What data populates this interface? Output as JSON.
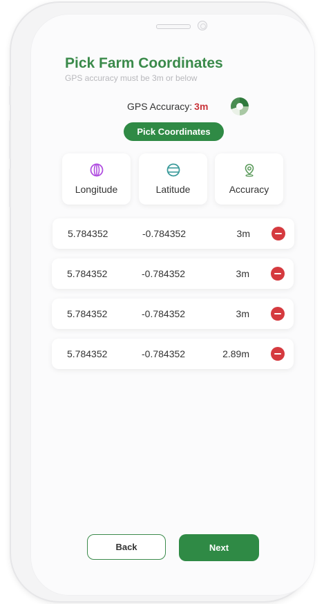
{
  "header": {
    "title": "Pick Farm Coordinates",
    "subtitle": "GPS accuracy must be 3m or below"
  },
  "gps": {
    "label": "GPS Accuracy:",
    "value": "3m",
    "value_color": "#c9343a",
    "indicator_icon": "loading-spinner-icon"
  },
  "pick_button": {
    "label": "Pick Coordinates"
  },
  "columns": [
    {
      "label": "Longitude",
      "icon": "globe-icon",
      "color": "#b04ee0"
    },
    {
      "label": "Latitude",
      "icon": "latitude-globe-icon",
      "color": "#3a9a9a"
    },
    {
      "label": "Accuracy",
      "icon": "location-pin-icon",
      "color": "#5a9a5a"
    }
  ],
  "rows": [
    {
      "longitude": "5.784352",
      "latitude": "-0.784352",
      "accuracy": "3m"
    },
    {
      "longitude": "5.784352",
      "latitude": "-0.784352",
      "accuracy": "3m"
    },
    {
      "longitude": "5.784352",
      "latitude": "-0.784352",
      "accuracy": "3m"
    },
    {
      "longitude": "5.784352",
      "latitude": "-0.784352",
      "accuracy": "2.89m"
    }
  ],
  "footer": {
    "back_label": "Back",
    "next_label": "Next"
  },
  "colors": {
    "brand_green": "#2f8a45",
    "remove_red": "#d53a3f"
  }
}
